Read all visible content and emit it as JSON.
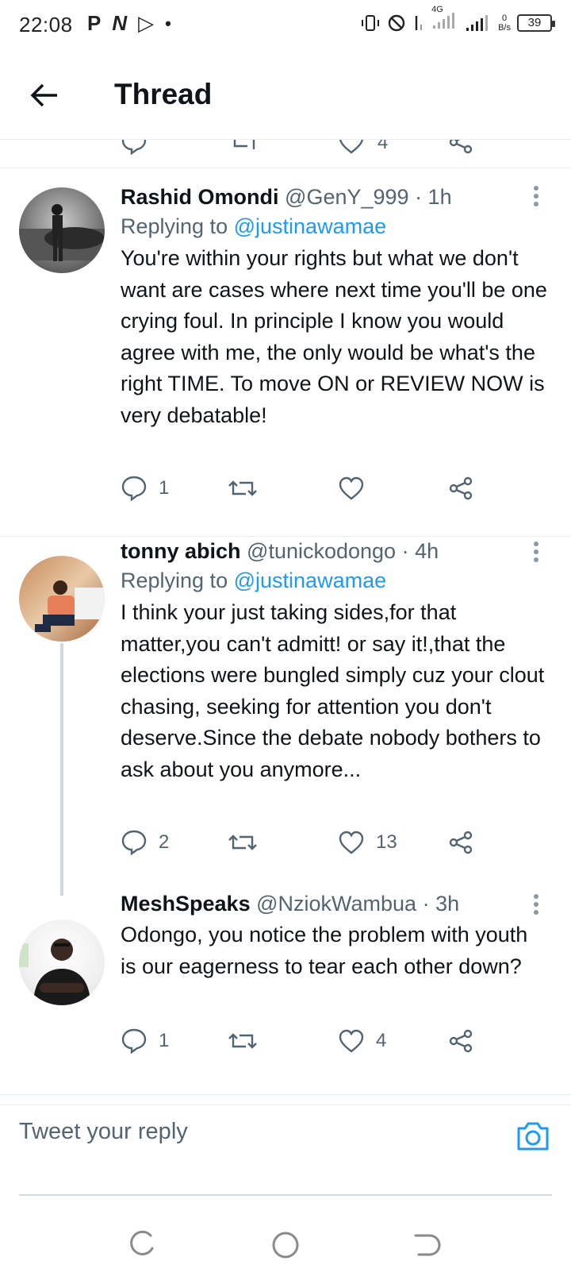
{
  "status_bar": {
    "time": "22:08",
    "left_icons": [
      "P",
      "N",
      "▷"
    ],
    "net_speed_value": "0",
    "net_speed_unit": "B/s",
    "battery": "39",
    "network": "4G"
  },
  "header": {
    "title": "Thread"
  },
  "previous_tweet": {
    "like_count": "4"
  },
  "tweets": [
    {
      "name": "Rashid Omondi",
      "handle": "@GenY_999",
      "time": "· 1h",
      "replying_label": "Replying to",
      "replying_to": "@justinawamae",
      "text": "You're within your rights but what we don't want are cases where next time you'll be one crying foul. In principle I know you would agree with me, the only would be what's the right TIME. To move ON or REVIEW NOW is very debatable!",
      "reply_count": "1",
      "retweet_count": "",
      "like_count": ""
    },
    {
      "name": "tonny abich",
      "handle": "@tunickodongo",
      "time": "· 4h",
      "replying_label": "Replying to",
      "replying_to": "@justinawamae",
      "text": "I think your just taking sides,for that matter,you can't admitt! or say it!,that the elections were bungled simply cuz your clout chasing, seeking for attention you don't deserve.Since the debate nobody bothers to ask about you anymore...",
      "reply_count": "2",
      "retweet_count": "",
      "like_count": "13"
    },
    {
      "name": "MeshSpeaks",
      "handle": "@NziokWambua",
      "time": "· 3h",
      "text": "Odongo, you notice the problem with youth is our eagerness to tear each other down?",
      "reply_count": "1",
      "retweet_count": "",
      "like_count": "4"
    }
  ],
  "reply_bar": {
    "placeholder": "Tweet your reply"
  },
  "colors": {
    "accent": "#1d9bf0",
    "secondary_text": "#536471",
    "primary_text": "#0f1419",
    "divider": "#e6ecf0"
  },
  "icons": {
    "back": "arrow-left-icon",
    "more": "more-vertical-icon",
    "reply": "speech-bubble-icon",
    "retweet": "retweet-icon",
    "like": "heart-icon",
    "share": "share-icon",
    "camera": "camera-icon"
  }
}
